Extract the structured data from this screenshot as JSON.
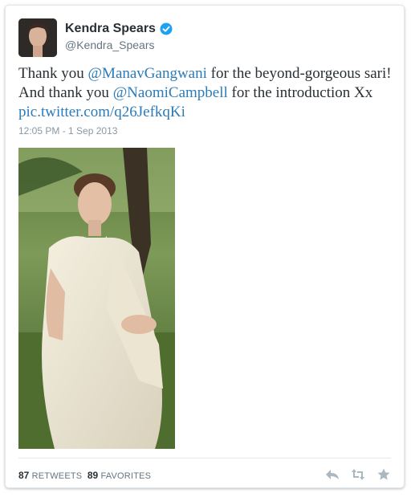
{
  "author": {
    "name": "Kendra Spears",
    "handle": "@Kendra_Spears",
    "verified_icon": "verified-badge-icon"
  },
  "tweet": {
    "text_1": "Thank you ",
    "mention_1": "@ManavGangwani",
    "text_2": " for the beyond-gorgeous sari! And thank you ",
    "mention_2": "@NaomiCampbell",
    "text_3": " for the introduction Xx ",
    "link": "pic.twitter.com/q26JefkqKi",
    "timestamp": "12:05 PM - 1 Sep 2013"
  },
  "stats": {
    "retweets_count": "87",
    "retweets_label": "RETWEETS",
    "favorites_count": "89",
    "favorites_label": "FAVORITES"
  },
  "actions": {
    "reply_icon": "reply-icon",
    "retweet_icon": "retweet-icon",
    "favorite_icon": "star-icon"
  },
  "colors": {
    "link": "#2b7bb9",
    "verified": "#1da1f2",
    "icon": "#aab8c2"
  }
}
